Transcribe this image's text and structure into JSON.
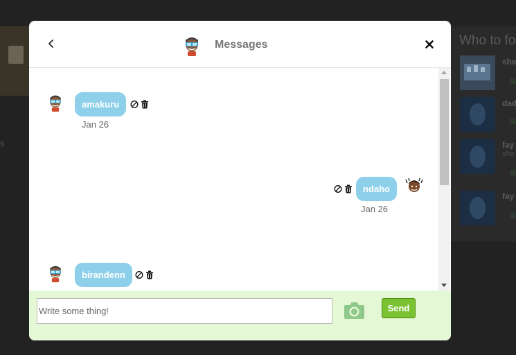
{
  "background": {
    "sidebar_title": "Who to fo",
    "suggestions": [
      {
        "name": "she",
        "sub": ""
      },
      {
        "name": "dad",
        "sub": ""
      },
      {
        "name": "fay",
        "sub": "she"
      },
      {
        "name": "fay",
        "sub": ""
      }
    ],
    "left_text": "s"
  },
  "modal": {
    "title": "Messages",
    "back_icon": "chevron-left-icon",
    "close_icon": "close-icon"
  },
  "messages": [
    {
      "text": "amakuru",
      "date": "Jan 26",
      "side": "left",
      "sender_avatar": "user-avatar-goggles"
    },
    {
      "text": "ndaho",
      "date": "Jan 26",
      "side": "right",
      "sender_avatar": "user-avatar-curly"
    },
    {
      "text": "birandenn",
      "date": "",
      "side": "left",
      "sender_avatar": "user-avatar-goggles"
    }
  ],
  "message_actions": [
    "block-icon",
    "trash-icon"
  ],
  "composer": {
    "placeholder": "Write some thing!",
    "value": "",
    "camera_icon": "camera-icon",
    "send_label": "Send"
  },
  "colors": {
    "bubble": "#8ed0ea",
    "footer": "#e4f8d6",
    "send_button": "#7ac231",
    "overlay": "#222222"
  }
}
